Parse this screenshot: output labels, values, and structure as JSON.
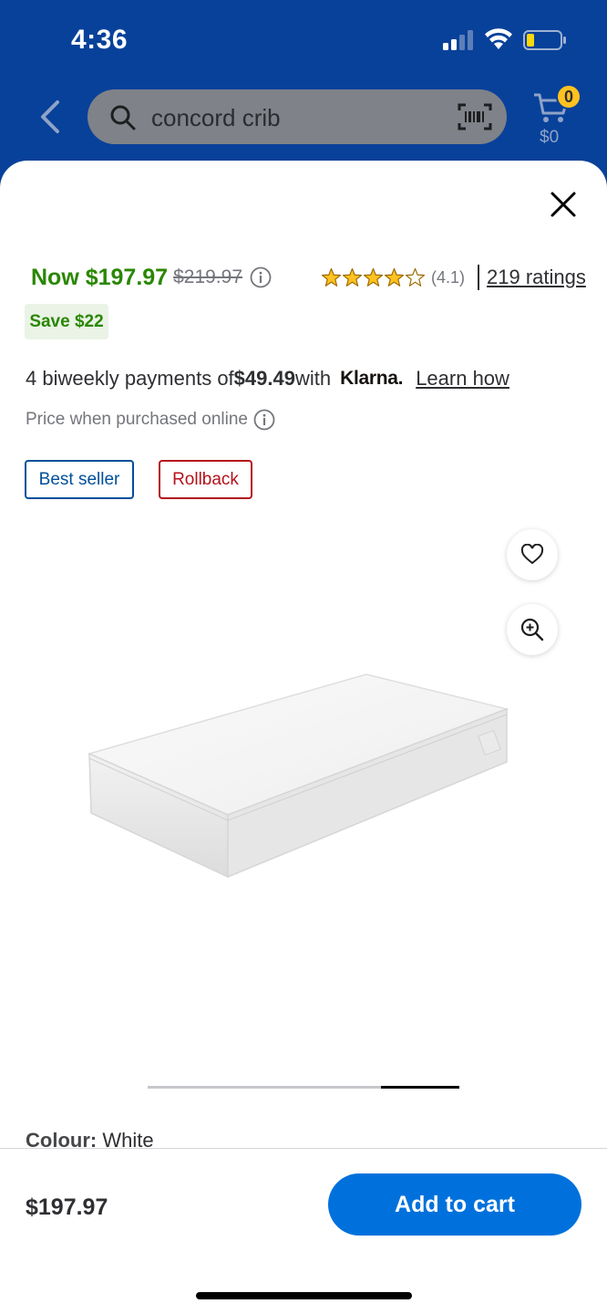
{
  "status_bar": {
    "time": "4:36"
  },
  "nav": {
    "search_value": "concord crib",
    "cart_count": "0",
    "cart_total": "$0"
  },
  "product": {
    "now_price": "Now $197.97",
    "was_price": "$219.97",
    "rating_value": "(4.1)",
    "rating_stars": 4.1,
    "rating_count": "219 ratings",
    "save_label": "Save $22",
    "klarna_prefix": "4 biweekly payments of ",
    "klarna_amount": "$49.49",
    "klarna_with": " with",
    "klarna_brand": "Klarna.",
    "learn_how": "Learn how",
    "price_online": "Price when purchased online",
    "flags": [
      "Best seller",
      "Rollback"
    ],
    "colour_label": "Colour:",
    "colour_value": " White",
    "carousel_position": 0.75
  },
  "bottom_bar": {
    "price": "$197.97",
    "add_to_cart": "Add to cart"
  },
  "colors": {
    "header_bg": "#08419a",
    "price_green": "#2a8703",
    "primary_blue": "#0071dc",
    "rollback_red": "#b5121b",
    "star_yellow": "#ffc220"
  }
}
